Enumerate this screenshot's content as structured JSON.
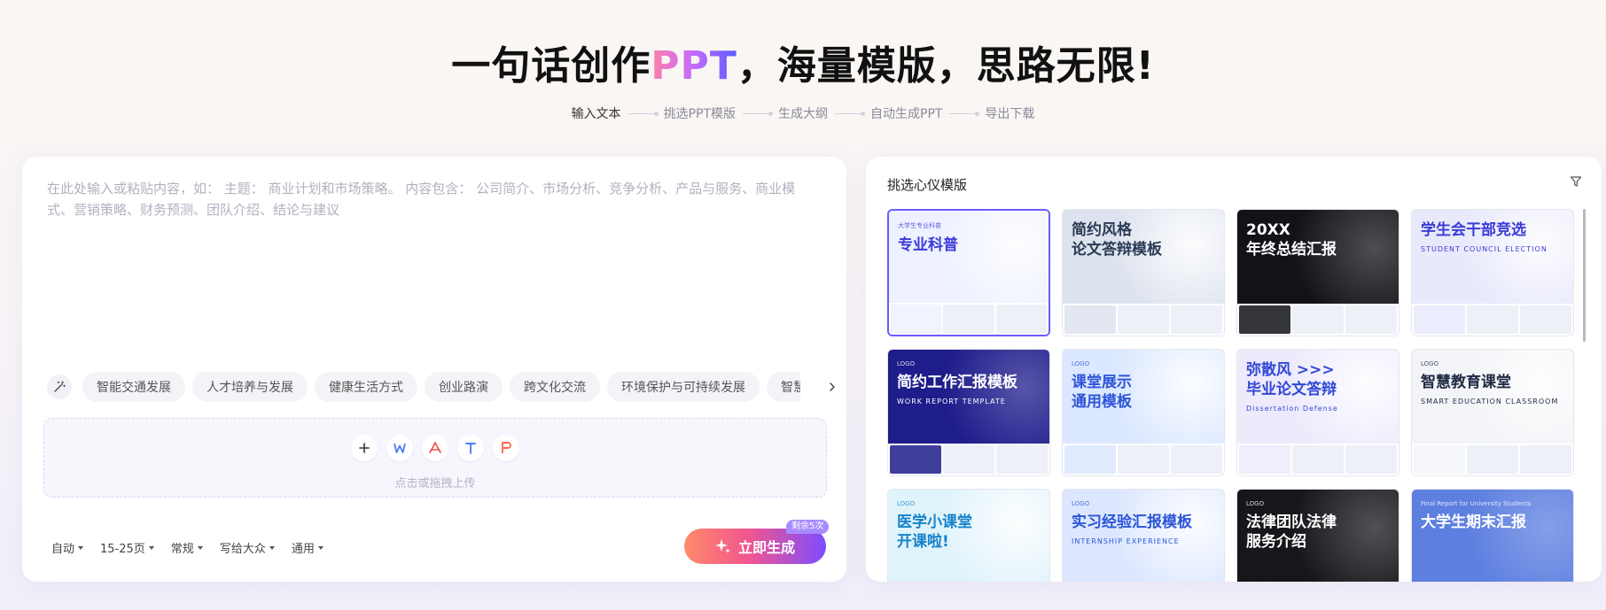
{
  "hero": {
    "prefix": "一句话创作",
    "highlight": "PPT",
    "suffix": "，海量模版，思路无限!"
  },
  "steps": [
    "输入文本",
    "挑选PPT模版",
    "生成大纲",
    "自动生成PPT",
    "导出下载"
  ],
  "input": {
    "placeholder": "在此处输入或粘贴内容，如： 主题： 商业计划和市场策略。 内容包含： 公司简介、市场分析、竞争分析、产品与服务、商业模式、营销策略、财务预测、团队介绍、结论与建议"
  },
  "topics": [
    "智能交通发展",
    "人才培养与发展",
    "健康生活方式",
    "创业路演",
    "跨文化交流",
    "环境保护与可持续发展",
    "智慧"
  ],
  "upload": {
    "hint": "点击或拖拽上传"
  },
  "options": [
    "自动",
    "15-25页",
    "常规",
    "写给大众",
    "通用"
  ],
  "generate": {
    "label": "立即生成",
    "badge": "剩余5次"
  },
  "templates_panel": {
    "title": "挑选心仪模版",
    "items": [
      {
        "line1": "专业科普",
        "line2": "",
        "tag": "大学生专业科普",
        "sub": "",
        "bg": "#eef1ff",
        "fg": "#3a3ad8",
        "selected": true
      },
      {
        "line1": "简约风格",
        "line2": "论文答辩模板",
        "tag": "",
        "sub": "",
        "bg": "#dde3ee",
        "fg": "#2b3a55",
        "selected": false
      },
      {
        "line1": "20XX",
        "line2": "年终总结汇报",
        "tag": "",
        "sub": "",
        "bg": "#111318",
        "fg": "#ffffff",
        "selected": false
      },
      {
        "line1": "学生会干部竞选",
        "line2": "",
        "tag": "",
        "sub": "STUDENT COUNCIL ELECTION",
        "bg": "#e8e9fb",
        "fg": "#3b3cd6",
        "selected": false
      },
      {
        "line1": "简约工作汇报模板",
        "line2": "",
        "tag": "LOGO",
        "sub": "WORK REPORT TEMPLATE",
        "bg": "#1f1c8c",
        "fg": "#ffffff",
        "selected": false
      },
      {
        "line1": "课堂展示",
        "line2": "通用模板",
        "tag": "LOGO",
        "sub": "",
        "bg": "#dbe8ff",
        "fg": "#2f56d9",
        "selected": false
      },
      {
        "line1": "弥散风 >>>",
        "line2": "毕业论文答辩",
        "tag": "",
        "sub": "Dissertation Defense",
        "bg": "#eeeafc",
        "fg": "#3048d6",
        "selected": false
      },
      {
        "line1": "智慧教育课堂",
        "line2": "",
        "tag": "LOGO",
        "sub": "SMART EDUCATION CLASSROOM",
        "bg": "#f3f4f8",
        "fg": "#1f2a44",
        "selected": false
      },
      {
        "line1": "医学小课堂",
        "line2": "开课啦!",
        "tag": "LOGO",
        "sub": "",
        "bg": "#dff3fb",
        "fg": "#1683c9",
        "selected": false
      },
      {
        "line1": "实习经验汇报模板",
        "line2": "",
        "tag": "LOGO",
        "sub": "INTERNSHIP EXPERIENCE",
        "bg": "#dce7ff",
        "fg": "#2b55d8",
        "selected": false
      },
      {
        "line1": "法律团队法律",
        "line2": "服务介绍",
        "tag": "LOGO",
        "sub": "",
        "bg": "#16171b",
        "fg": "#ffffff",
        "selected": false
      },
      {
        "line1": "大学生期末汇报",
        "line2": "",
        "tag": "Final Report for University Students",
        "sub": "",
        "bg": "#5d7fe0",
        "fg": "#ffffff",
        "selected": false
      }
    ]
  },
  "colors": {
    "accent": "#6a5cff",
    "gradient_start": "#ff8a6a",
    "gradient_end": "#7c4dff"
  }
}
